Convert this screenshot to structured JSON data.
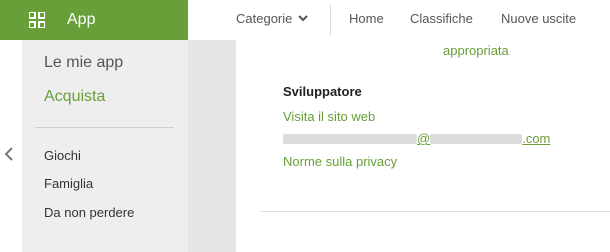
{
  "header": {
    "app_label": "App",
    "nav": {
      "categorie": "Categorie",
      "home": "Home",
      "classifiche": "Classifiche",
      "nuove_uscite": "Nuove uscite"
    }
  },
  "sidebar": {
    "my_apps": "Le mie app",
    "acquista": "Acquista",
    "categories": [
      "Giochi",
      "Famiglia",
      "Da non perdere"
    ]
  },
  "content": {
    "truncated_text": "appropriata",
    "developer_heading": "Sviluppatore",
    "website_link": "Visita il sito web",
    "email_visible_parts": [
      "@",
      ".com"
    ],
    "privacy_link": "Norme sulla privacy"
  },
  "colors": {
    "accent": "#689f38",
    "sidebar_bg": "#eeeeee",
    "band_bg": "#e6e6e6"
  },
  "icons": [
    "grid-icon",
    "chevron-down-icon",
    "chevron-left-icon"
  ]
}
